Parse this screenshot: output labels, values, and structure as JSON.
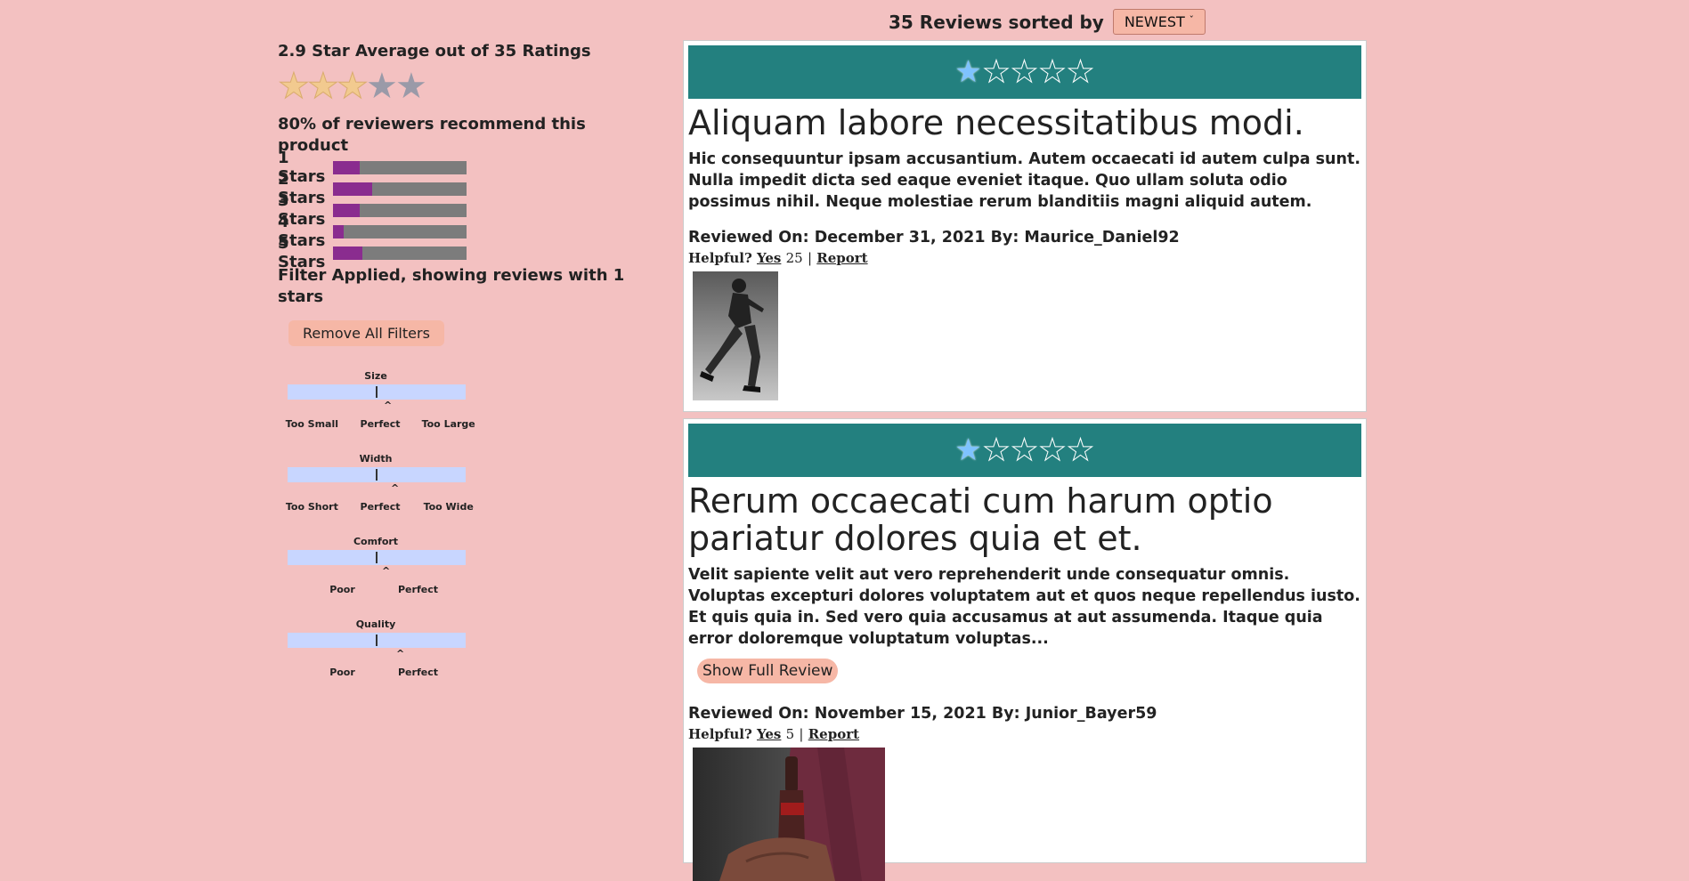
{
  "summary": {
    "average_text": "2.9 Star Average out of 35 Ratings",
    "average_rating": 2.9,
    "recommend_text": "80% of reviewers recommend this product",
    "star_breakdown": [
      {
        "label": "1 Stars",
        "fraction": 0.2
      },
      {
        "label": "2 Stars",
        "fraction": 0.29
      },
      {
        "label": "3 Stars",
        "fraction": 0.2
      },
      {
        "label": "4 Stars",
        "fraction": 0.08
      },
      {
        "label": "5 Stars",
        "fraction": 0.22
      }
    ],
    "filter_text": "Filter Applied, showing reviews with 1 stars",
    "remove_filters_label": "Remove All Filters"
  },
  "characteristics": [
    {
      "title": "Size",
      "marker": "^",
      "value": 0.56,
      "labels": [
        "Too Small",
        "Perfect",
        "Too Large"
      ]
    },
    {
      "title": "Width",
      "marker": "^",
      "value": 0.6,
      "labels": [
        "Too Short",
        "Perfect",
        "Too Wide"
      ]
    },
    {
      "title": "Comfort",
      "marker": "^",
      "value": 0.55,
      "labels": [
        "Poor",
        "Perfect"
      ]
    },
    {
      "title": "Quality",
      "marker": "^",
      "value": 0.63,
      "labels": [
        "Poor",
        "Perfect"
      ]
    }
  ],
  "sort": {
    "text": "35 Reviews sorted by",
    "selected": "NEWEST",
    "caret": "ˇ"
  },
  "reviews": [
    {
      "rating": 1,
      "star_glyph": "★",
      "title": "Aliquam labore necessitatibus modi.",
      "body": "Hic consequuntur ipsam accusantium. Autem occaecati id autem culpa sunt. Nulla impedit dicta sed eaque eveniet itaque. Quo ullam soluta odio possimus nihil. Neque molestiae rerum blanditiis magni aliquid autem.",
      "meta": "Reviewed On: December 31, 2021 By: Maurice_Daniel92",
      "helpful_label": "Helpful?",
      "yes_label": "Yes",
      "helpful_count": "25",
      "separator": "|",
      "report_label": "Report"
    },
    {
      "rating": 1,
      "star_glyph": "★",
      "title": "Rerum occaecati cum harum optio pariatur dolores quia et et.",
      "body": "Velit sapiente velit aut vero reprehenderit unde consequatur omnis. Voluptas excepturi dolores voluptatem aut et quos neque repellendus iusto. Et quis quia in. Sed vero quia accusamus at aut assumenda. Itaque quia error doloremque voluptatum voluptas...",
      "show_full_label": "Show Full Review",
      "meta": "Reviewed On: November 15, 2021 By: Junior_Bayer59",
      "helpful_label": "Helpful?",
      "yes_label": "Yes",
      "helpful_count": "5",
      "separator": "|",
      "report_label": "Report"
    }
  ],
  "colors": {
    "background": "#f3c1c1",
    "header_band": "#23807f",
    "bar_fill": "#8a2c8f",
    "bar_track": "#7c7c7c",
    "char_track": "#c8d6ff",
    "button": "#f6b7a6"
  }
}
